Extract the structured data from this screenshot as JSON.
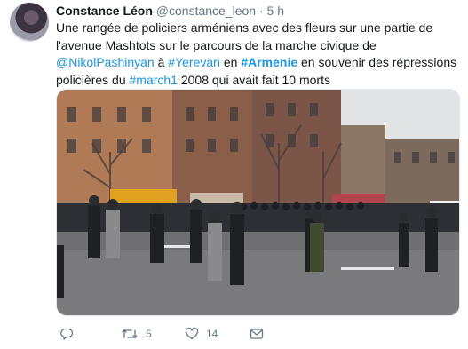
{
  "author": {
    "name": "Constance Léon",
    "handle": "@constance_leon",
    "separator": "·",
    "time": "5 h"
  },
  "tweet": {
    "t1": "Une rangée de policiers arméniens avec des fleurs sur une partie de l'avenue Mashtots sur le parcours de la marche civique de ",
    "mention": "@NikolPashinyan",
    "t2": " à ",
    "tag1": "#Yerevan",
    "t3": " en ",
    "tag2": "#Armenie",
    "t4": " en souvenir des répressions policières du ",
    "tag3": "#march1",
    "t5": " 2008 qui avait fait 10 morts"
  },
  "actions": {
    "retweets": "5",
    "likes": "14"
  },
  "colors": {
    "link": "#1b95e0",
    "muted": "#657786"
  }
}
